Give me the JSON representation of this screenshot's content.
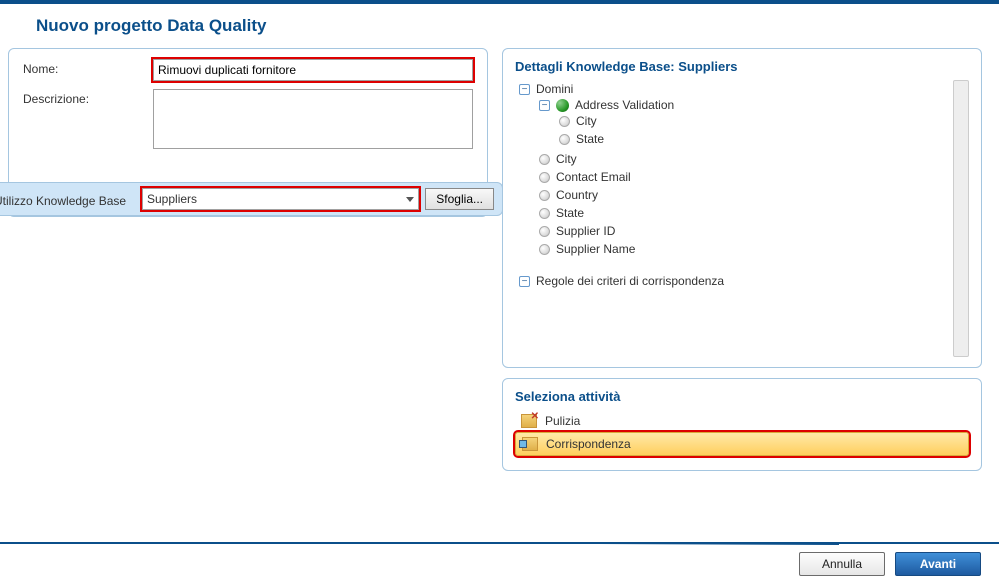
{
  "page": {
    "title": "Nuovo progetto Data Quality"
  },
  "form": {
    "name_label": "Nome:",
    "name_value": "Rimuovi duplicati fornitore",
    "desc_label": "Descrizione:",
    "desc_value": "",
    "kb_label": "Utilizzo Knowledge Base",
    "kb_value": "Suppliers",
    "browse_label": "Sfoglia..."
  },
  "kb": {
    "title": "Dettagli Knowledge Base: Suppliers",
    "root_domains": "Domini",
    "address_validation": "Address Validation",
    "av_city": "City",
    "av_state": "State",
    "d_city": "City",
    "d_contact": "Contact Email",
    "d_country": "Country",
    "d_state": "State",
    "d_supplier_id": "Supplier ID",
    "d_supplier_name": "Supplier Name",
    "rules": "Regole dei criteri di corrispondenza"
  },
  "activity": {
    "title": "Seleziona attività",
    "clean": "Pulizia",
    "match": "Corrispondenza"
  },
  "footer": {
    "cancel": "Annulla",
    "next": "Avanti"
  }
}
